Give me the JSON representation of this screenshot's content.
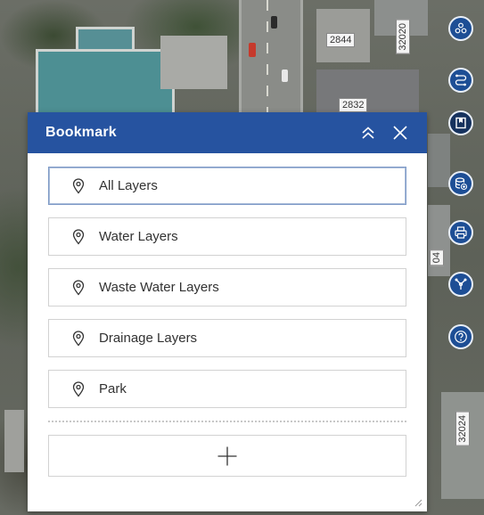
{
  "map": {
    "lot_labels": [
      "2844",
      "2832",
      "32020",
      "04",
      "32024"
    ]
  },
  "toolbar": {
    "items": [
      {
        "icon": "layers-icon"
      },
      {
        "icon": "route-icon"
      },
      {
        "icon": "bookmark-icon",
        "active": true
      },
      {
        "icon": "database-add-icon"
      },
      {
        "icon": "print-icon"
      },
      {
        "icon": "network-trace-icon"
      },
      {
        "icon": "help-icon"
      }
    ]
  },
  "panel": {
    "title": "Bookmark",
    "bookmarks": [
      {
        "label": "All Layers",
        "selected": true
      },
      {
        "label": "Water Layers"
      },
      {
        "label": "Waste Water Layers"
      },
      {
        "label": "Drainage Layers"
      },
      {
        "label": "Park"
      }
    ]
  },
  "colors": {
    "header": "#2653a0",
    "toolbar_button": "#1d4e95",
    "toolbar_active": "#16325e"
  }
}
